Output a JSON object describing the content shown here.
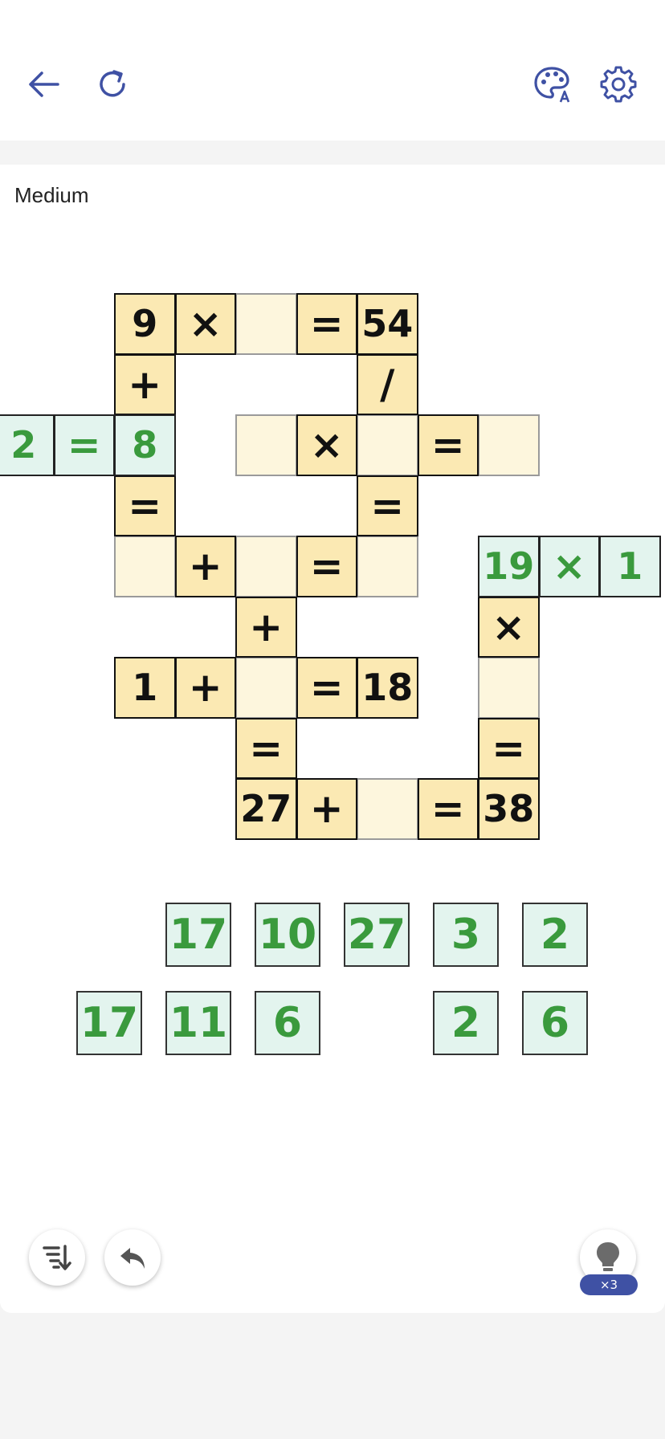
{
  "difficulty": "Medium",
  "icons": {
    "back": "arrow-left-icon",
    "restart": "refresh-icon",
    "theme": "palette-icon",
    "settings": "gear-icon",
    "sort": "sort-down-icon",
    "undo": "undo-icon",
    "hint": "lightbulb-icon"
  },
  "colors": {
    "accent": "#3f51a4",
    "given_cell": "#fbe9b3",
    "empty_cell": "#fdf6dd",
    "placed_cell": "#e3f4ee",
    "placed_text": "#3a9a3d"
  },
  "hint_count": "×3",
  "board": {
    "given": [
      {
        "r": 0,
        "c": 2,
        "t": "9"
      },
      {
        "r": 0,
        "c": 3,
        "t": "×"
      },
      {
        "r": 0,
        "c": 5,
        "t": "="
      },
      {
        "r": 0,
        "c": 6,
        "t": "54"
      },
      {
        "r": 1,
        "c": 2,
        "t": "+"
      },
      {
        "r": 1,
        "c": 6,
        "t": "/"
      },
      {
        "r": 2,
        "c": 5,
        "t": "×"
      },
      {
        "r": 2,
        "c": 7,
        "t": "="
      },
      {
        "r": 3,
        "c": 2,
        "t": "="
      },
      {
        "r": 3,
        "c": 6,
        "t": "="
      },
      {
        "r": 4,
        "c": 3,
        "t": "+"
      },
      {
        "r": 4,
        "c": 5,
        "t": "="
      },
      {
        "r": 5,
        "c": 4,
        "t": "+"
      },
      {
        "r": 5,
        "c": 8,
        "t": "×"
      },
      {
        "r": 6,
        "c": 2,
        "t": "1"
      },
      {
        "r": 6,
        "c": 3,
        "t": "+"
      },
      {
        "r": 6,
        "c": 5,
        "t": "="
      },
      {
        "r": 6,
        "c": 6,
        "t": "18"
      },
      {
        "r": 7,
        "c": 4,
        "t": "="
      },
      {
        "r": 7,
        "c": 8,
        "t": "="
      },
      {
        "r": 8,
        "c": 4,
        "t": "27"
      },
      {
        "r": 8,
        "c": 5,
        "t": "+"
      },
      {
        "r": 8,
        "c": 7,
        "t": "="
      },
      {
        "r": 8,
        "c": 8,
        "t": "38"
      }
    ],
    "empty": [
      {
        "r": 0,
        "c": 4
      },
      {
        "r": 2,
        "c": 4
      },
      {
        "r": 2,
        "c": 6
      },
      {
        "r": 2,
        "c": 8
      },
      {
        "r": 4,
        "c": 2
      },
      {
        "r": 4,
        "c": 4
      },
      {
        "r": 4,
        "c": 6
      },
      {
        "r": 6,
        "c": 4
      },
      {
        "r": 6,
        "c": 8
      },
      {
        "r": 8,
        "c": 6
      }
    ],
    "placed": [
      {
        "r": 2,
        "c": 0,
        "t": "2"
      },
      {
        "r": 2,
        "c": 1,
        "t": "="
      },
      {
        "r": 2,
        "c": 2,
        "t": "8"
      },
      {
        "r": 4,
        "c": 8,
        "t": "19"
      },
      {
        "r": 4,
        "c": 9,
        "t": "×"
      },
      {
        "r": 4,
        "c": 10,
        "t": "1"
      }
    ]
  },
  "tiles": {
    "row1": [
      {
        "slot": 1,
        "t": "17"
      },
      {
        "slot": 2,
        "t": "10"
      },
      {
        "slot": 3,
        "t": "27"
      },
      {
        "slot": 4,
        "t": "3"
      },
      {
        "slot": 5,
        "t": "2"
      }
    ],
    "row2": [
      {
        "slot": 0,
        "t": "17"
      },
      {
        "slot": 1,
        "t": "11"
      },
      {
        "slot": 2,
        "t": "6"
      },
      {
        "slot": 4,
        "t": "2"
      },
      {
        "slot": 5,
        "t": "6"
      }
    ]
  }
}
